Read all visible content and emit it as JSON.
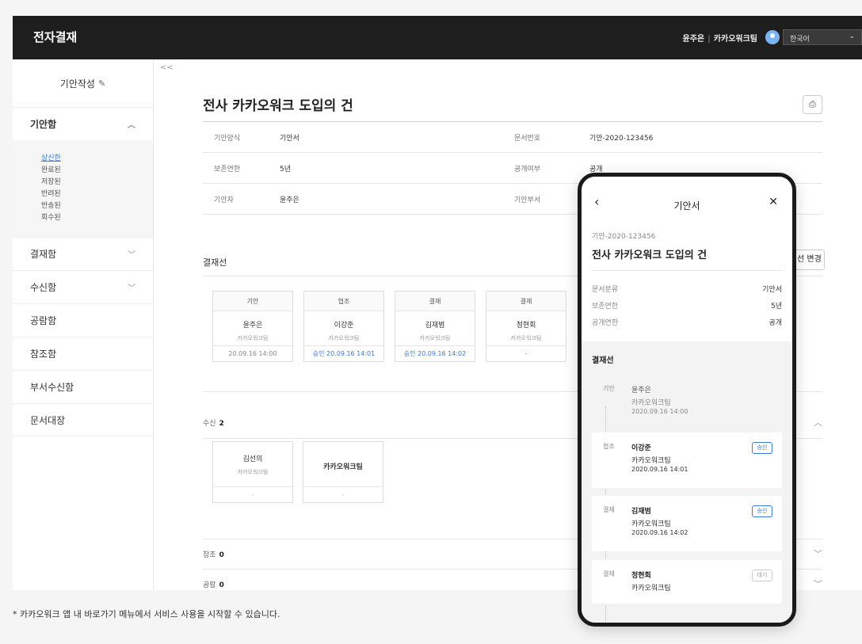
{
  "header": {
    "brand": "전자결재",
    "user_name": "윤주은",
    "team": "카카오워크팀",
    "language": "한국어"
  },
  "sidebar": {
    "compose_label": "기안작성",
    "collapse_label": "<<",
    "draft_box": "기안함",
    "draft_sub": [
      "상신한",
      "완료된",
      "저장된",
      "반려된",
      "반송된",
      "회수된"
    ],
    "items": [
      "결재함",
      "수신함",
      "공람함",
      "참조함",
      "부서수신함",
      "문서대장"
    ]
  },
  "document": {
    "title": "전사 카카오워크 도입의 건",
    "info": [
      {
        "k1": "기안양식",
        "v1": "기안서",
        "k2": "문서번호",
        "v2": "기안-2020-123456"
      },
      {
        "k1": "보존연한",
        "v1": "5년",
        "k2": "공개여부",
        "v2": "공개"
      },
      {
        "k1": "기안자",
        "v1": "윤주은",
        "k2": "기안부서",
        "v2": ""
      }
    ],
    "approval_line_title": "결재선",
    "line_change_label": "선 변경",
    "approvers": [
      {
        "role": "기안",
        "name": "윤주은",
        "team": "카카오워크팀",
        "date": "20.09.16 14:00",
        "ok": false
      },
      {
        "role": "협조",
        "name": "이강준",
        "team": "카카오워크팀",
        "date": "승인 20.09.16 14:01",
        "ok": true
      },
      {
        "role": "결재",
        "name": "김재범",
        "team": "카카오워크팀",
        "date": "승인 20.09.16 14:02",
        "ok": true
      },
      {
        "role": "결재",
        "name": "정현회",
        "team": "카카오워크팀",
        "date": "-",
        "ok": false
      }
    ],
    "recv_label": "수신",
    "recv_count": "2",
    "receivers": [
      {
        "name": "김선의",
        "team": "카카오워크팀",
        "dash": "-"
      },
      {
        "name": "카카오워크팀",
        "dash": "-"
      }
    ],
    "ref_label": "참조",
    "ref_count": "0",
    "share_label": "공람",
    "share_count": "0"
  },
  "footnote": "* 카카오워크 앱 내 바로가기 메뉴에서 서비스 사용을 시작할 수 있습니다.",
  "phone": {
    "title": "기안서",
    "doc_no": "기안-2020-123456",
    "doc_title": "전사 카카오워크 도입의 건",
    "meta": [
      {
        "k": "문서분류",
        "v": "기안서"
      },
      {
        "k": "보존연한",
        "v": "5년"
      },
      {
        "k": "공개연한",
        "v": "공개"
      }
    ],
    "line_title": "결재선",
    "steps": [
      {
        "role": "기안",
        "name": "윤주은",
        "team": "카카오워크팀",
        "date": "2020.09.16 14:00",
        "badge": ""
      },
      {
        "role": "협조",
        "name": "이강준",
        "team": "카카오워크팀",
        "date": "2020.09.16 14:01",
        "badge": "승인"
      },
      {
        "role": "결재",
        "name": "김재범",
        "team": "카카오워크팀",
        "date": "2020.09.16 14:02",
        "badge": "승인"
      },
      {
        "role": "결재",
        "name": "정현회",
        "team": "카카오워크팀",
        "date": "",
        "badge": "대기"
      }
    ]
  }
}
